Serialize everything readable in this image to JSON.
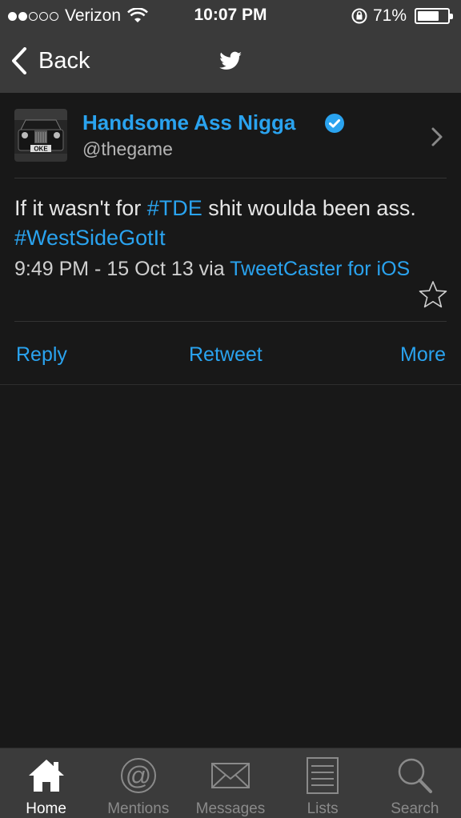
{
  "status_bar": {
    "carrier": "Verizon",
    "time": "10:07 PM",
    "battery": "71%",
    "battery_level": 0.71,
    "signal_bars": 2
  },
  "nav": {
    "back_label": "Back",
    "logo_icon": "twitter-bird-icon"
  },
  "tweet": {
    "display_name": "Handsome Ass Nigga",
    "handle": "@thegame",
    "verified": true,
    "avatar_text": "OKE",
    "text_part1": "If it wasn't for ",
    "hashtag1": "#TDE",
    "text_part2": " shit woulda been ass. ",
    "hashtag2": "#WestSideGotIt",
    "timestamp": "9:49 PM - 15 Oct 13 via ",
    "source": "TweetCaster for iOS",
    "actions": {
      "reply": "Reply",
      "retweet": "Retweet",
      "more": "More"
    }
  },
  "tab_bar": [
    {
      "label": "Home",
      "icon": "home-icon",
      "active": true
    },
    {
      "label": "Mentions",
      "icon": "at-sign-icon",
      "active": false
    },
    {
      "label": "Messages",
      "icon": "envelope-icon",
      "active": false
    },
    {
      "label": "Lists",
      "icon": "list-icon",
      "active": false
    },
    {
      "label": "Search",
      "icon": "search-icon",
      "active": false
    }
  ],
  "colors": {
    "accent": "#2aa3ef",
    "background": "#181818",
    "bar": "#3a3a3a"
  }
}
